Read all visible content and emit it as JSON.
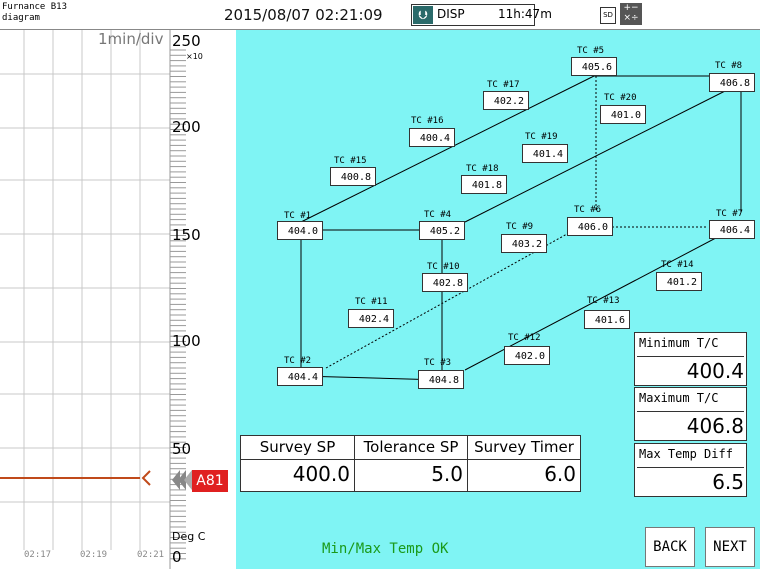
{
  "header": {
    "title_line1": "Furnance B13",
    "title_line2": "diagram",
    "datetime": "2015/08/07  02:21:09",
    "disp_label": "DISP",
    "disp_remaining": "11h:47m",
    "sd_label": "SD"
  },
  "trend": {
    "time_div": "1min/div",
    "y_scale_factor": "×10",
    "y_ticks": [
      "250",
      "200",
      "150",
      "100",
      "50",
      "0"
    ],
    "unit": "Deg C",
    "time_ticks": [
      "02:17",
      "02:19",
      "02:21"
    ],
    "alarm_tag": "A81",
    "alarm_color": "#e02020",
    "trace_color": "#c04a1a"
  },
  "thermocouples": [
    {
      "id": "tc1",
      "name": "TC #1",
      "value": "404.0"
    },
    {
      "id": "tc2",
      "name": "TC #2",
      "value": "404.4"
    },
    {
      "id": "tc3",
      "name": "TC #3",
      "value": "404.8"
    },
    {
      "id": "tc4",
      "name": "TC #4",
      "value": "405.2"
    },
    {
      "id": "tc5",
      "name": "TC #5",
      "value": "405.6"
    },
    {
      "id": "tc6",
      "name": "TC #6",
      "value": "406.0"
    },
    {
      "id": "tc7",
      "name": "TC #7",
      "value": "406.4"
    },
    {
      "id": "tc8",
      "name": "TC #8",
      "value": "406.8"
    },
    {
      "id": "tc9",
      "name": "TC #9",
      "value": "403.2"
    },
    {
      "id": "tc10",
      "name": "TC #10",
      "value": "402.8"
    },
    {
      "id": "tc11",
      "name": "TC #11",
      "value": "402.4"
    },
    {
      "id": "tc12",
      "name": "TC #12",
      "value": "402.0"
    },
    {
      "id": "tc13",
      "name": "TC #13",
      "value": "401.6"
    },
    {
      "id": "tc14",
      "name": "TC #14",
      "value": "401.2"
    },
    {
      "id": "tc15",
      "name": "TC #15",
      "value": "400.8"
    },
    {
      "id": "tc16",
      "name": "TC #16",
      "value": "400.4"
    },
    {
      "id": "tc17",
      "name": "TC #17",
      "value": "402.2"
    },
    {
      "id": "tc18",
      "name": "TC #18",
      "value": "401.8"
    },
    {
      "id": "tc19",
      "name": "TC #19",
      "value": "401.4"
    },
    {
      "id": "tc20",
      "name": "TC #20",
      "value": "401.0"
    }
  ],
  "survey": {
    "sp_label": "Survey SP",
    "sp_value": "400.0",
    "tol_label": "Tolerance SP",
    "tol_value": "5.0",
    "timer_label": "Survey Timer",
    "timer_value": "6.0"
  },
  "stats": {
    "min_label": "Minimum T/C",
    "min_value": "400.4",
    "max_label": "Maximum T/C",
    "max_value": "406.8",
    "diff_label": "Max Temp Diff",
    "diff_value": "6.5"
  },
  "status": {
    "text": "Min/Max Temp OK",
    "color": "#1a9a1a"
  },
  "buttons": {
    "back": "BACK",
    "next": "NEXT"
  },
  "colors": {
    "panel_bg": "#7ff4f4"
  }
}
